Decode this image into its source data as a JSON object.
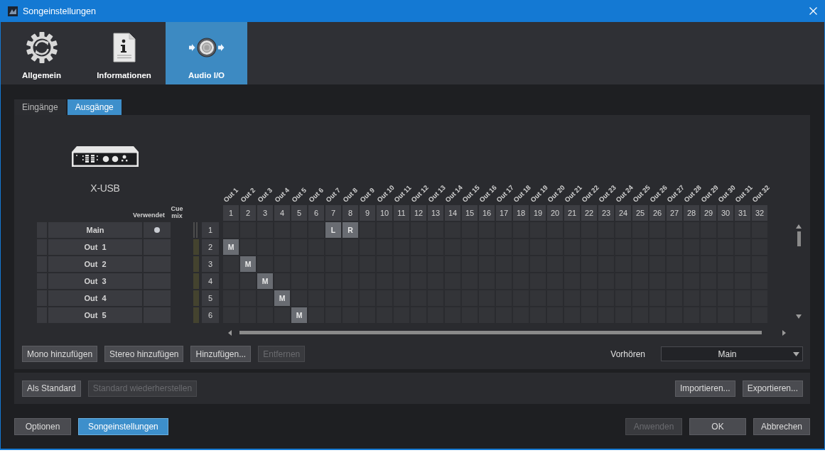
{
  "window": {
    "title": "Songeinstellungen"
  },
  "categories": [
    {
      "kind": "general",
      "label": "Allgemein",
      "selected": false
    },
    {
      "kind": "info",
      "label": "Informationen",
      "selected": false
    },
    {
      "kind": "audio",
      "label": "Audio I/O",
      "selected": true
    }
  ],
  "io_tabs": [
    {
      "label": "Eingänge",
      "selected": false
    },
    {
      "label": "Ausgänge",
      "selected": true
    }
  ],
  "device": {
    "name": "X-USB"
  },
  "headers": {
    "used": "Verwendet",
    "cue_mix": "Cue mix"
  },
  "columns": [
    {
      "label": "Out 1",
      "number": "1"
    },
    {
      "label": "Out 2",
      "number": "2"
    },
    {
      "label": "Out 3",
      "number": "3"
    },
    {
      "label": "Out 4",
      "number": "4"
    },
    {
      "label": "Out 5",
      "number": "5"
    },
    {
      "label": "Out 6",
      "number": "6"
    },
    {
      "label": "Out 7",
      "number": "7"
    },
    {
      "label": "Out 8",
      "number": "8"
    },
    {
      "label": "Out 9",
      "number": "9"
    },
    {
      "label": "Out 10",
      "number": "10"
    },
    {
      "label": "Out 11",
      "number": "11"
    },
    {
      "label": "Out 12",
      "number": "12"
    },
    {
      "label": "Out 13",
      "number": "13"
    },
    {
      "label": "Out 14",
      "number": "14"
    },
    {
      "label": "Out 15",
      "number": "15"
    },
    {
      "label": "Out 16",
      "number": "16"
    },
    {
      "label": "Out 17",
      "number": "17"
    },
    {
      "label": "Out 18",
      "number": "18"
    },
    {
      "label": "Out 19",
      "number": "19"
    },
    {
      "label": "Out 20",
      "number": "20"
    },
    {
      "label": "Out 21",
      "number": "21"
    },
    {
      "label": "Out 22",
      "number": "22"
    },
    {
      "label": "Out 23",
      "number": "23"
    },
    {
      "label": "Out 24",
      "number": "24"
    },
    {
      "label": "Out 25",
      "number": "25"
    },
    {
      "label": "Out 26",
      "number": "26"
    },
    {
      "label": "Out 27",
      "number": "27"
    },
    {
      "label": "Out 28",
      "number": "28"
    },
    {
      "label": "Out 29",
      "number": "29"
    },
    {
      "label": "Out 30",
      "number": "30"
    },
    {
      "label": "Out 31",
      "number": "31"
    },
    {
      "label": "Out 32",
      "number": "32"
    }
  ],
  "rows": [
    {
      "kind": "main",
      "label": "Main",
      "number": "1",
      "used": true,
      "cells": [
        null,
        null,
        null,
        null,
        null,
        null,
        "L",
        "R",
        null,
        null,
        null,
        null,
        null,
        null,
        null,
        null,
        null,
        null,
        null,
        null,
        null,
        null,
        null,
        null,
        null,
        null,
        null,
        null,
        null,
        null,
        null,
        null
      ]
    },
    {
      "kind": "output",
      "label": "Out  1",
      "number": "2",
      "used": false,
      "cells": [
        "M",
        null,
        null,
        null,
        null,
        null,
        null,
        null,
        null,
        null,
        null,
        null,
        null,
        null,
        null,
        null,
        null,
        null,
        null,
        null,
        null,
        null,
        null,
        null,
        null,
        null,
        null,
        null,
        null,
        null,
        null,
        null
      ]
    },
    {
      "kind": "output",
      "label": "Out  2",
      "number": "3",
      "used": false,
      "cells": [
        null,
        "M",
        null,
        null,
        null,
        null,
        null,
        null,
        null,
        null,
        null,
        null,
        null,
        null,
        null,
        null,
        null,
        null,
        null,
        null,
        null,
        null,
        null,
        null,
        null,
        null,
        null,
        null,
        null,
        null,
        null,
        null
      ]
    },
    {
      "kind": "output",
      "label": "Out  3",
      "number": "4",
      "used": false,
      "cells": [
        null,
        null,
        "M",
        null,
        null,
        null,
        null,
        null,
        null,
        null,
        null,
        null,
        null,
        null,
        null,
        null,
        null,
        null,
        null,
        null,
        null,
        null,
        null,
        null,
        null,
        null,
        null,
        null,
        null,
        null,
        null,
        null
      ]
    },
    {
      "kind": "output",
      "label": "Out  4",
      "number": "5",
      "used": false,
      "cells": [
        null,
        null,
        null,
        "M",
        null,
        null,
        null,
        null,
        null,
        null,
        null,
        null,
        null,
        null,
        null,
        null,
        null,
        null,
        null,
        null,
        null,
        null,
        null,
        null,
        null,
        null,
        null,
        null,
        null,
        null,
        null,
        null
      ]
    },
    {
      "kind": "output",
      "label": "Out  5",
      "number": "6",
      "used": false,
      "cells": [
        null,
        null,
        null,
        null,
        "M",
        null,
        null,
        null,
        null,
        null,
        null,
        null,
        null,
        null,
        null,
        null,
        null,
        null,
        null,
        null,
        null,
        null,
        null,
        null,
        null,
        null,
        null,
        null,
        null,
        null,
        null,
        null
      ]
    }
  ],
  "buttons": [
    {
      "label": "Mono hinzufügen",
      "disabled": false
    },
    {
      "label": "Stereo hinzufügen",
      "disabled": false
    },
    {
      "label": "Hinzufügen...",
      "disabled": false
    },
    {
      "label": "Entfernen",
      "disabled": true
    }
  ],
  "preview": {
    "label": "Vorhören",
    "value": "Main"
  },
  "preset_buttons_left": [
    {
      "label": "Als Standard",
      "disabled": false
    },
    {
      "label": "Standard wiederherstellen",
      "disabled": true
    }
  ],
  "preset_buttons_right": [
    {
      "label": "Importieren...",
      "disabled": false
    },
    {
      "label": "Exportieren...",
      "disabled": false
    }
  ],
  "footer_left": [
    {
      "label": "Optionen",
      "selected": false
    },
    {
      "label": "Songeinstellungen",
      "selected": true
    }
  ],
  "footer_right": [
    {
      "label": "Anwenden",
      "disabled": true
    },
    {
      "label": "OK",
      "disabled": false
    },
    {
      "label": "Abbrechen",
      "disabled": false
    }
  ]
}
